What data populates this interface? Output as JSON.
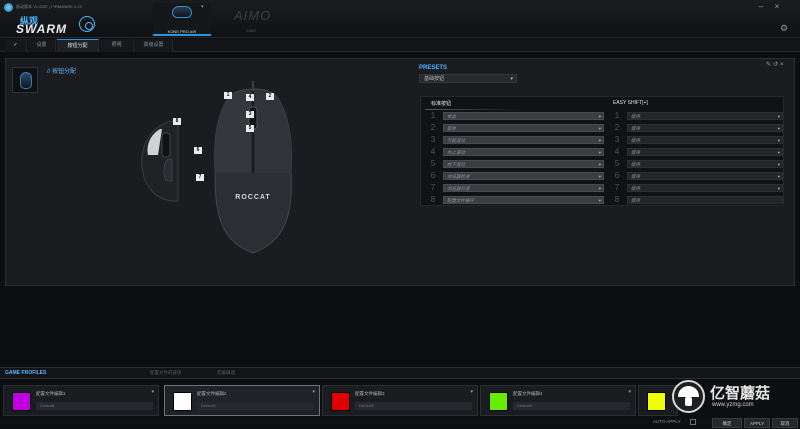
{
  "app": {
    "title_line": "驱动版本 V1.0297 | FIRMWARE 4.10",
    "brand_cn": "纵观",
    "brand_name": "SWARM"
  },
  "devices": [
    {
      "name": "KONE PRO AIR",
      "selected": true
    },
    {
      "name": "AIMO",
      "subtitle": "AIMO",
      "selected": false
    }
  ],
  "tabs": [
    {
      "label": "✔",
      "active": false
    },
    {
      "label": "设置",
      "active": false
    },
    {
      "label": "按钮分配",
      "active": true
    },
    {
      "label": "照明",
      "active": false
    },
    {
      "label": "高级设置",
      "active": false
    }
  ],
  "main": {
    "section_title": "// 按钮分配",
    "presets_label": "PRESETS",
    "preset_value": "基础按钮",
    "col_standard": "标准按钮",
    "col_easyshift": "EASY SHIFT[+]",
    "mouse_logo": "ROCCAT"
  },
  "button_markers": [
    "1",
    "2",
    "3",
    "4",
    "5",
    "6",
    "7",
    "8"
  ],
  "standard_rows": [
    {
      "num": "1",
      "value": "单击"
    },
    {
      "num": "2",
      "value": "菜单"
    },
    {
      "num": "3",
      "value": "万能滚动"
    },
    {
      "num": "4",
      "value": "向上滚动"
    },
    {
      "num": "5",
      "value": "向下滚动"
    },
    {
      "num": "6",
      "value": "浏览器前进"
    },
    {
      "num": "7",
      "value": "浏览器后退"
    },
    {
      "num": "8",
      "value": "配置文件循环"
    }
  ],
  "easyshift_rows": [
    {
      "num": "1",
      "value": "禁用"
    },
    {
      "num": "2",
      "value": "禁用"
    },
    {
      "num": "3",
      "value": "禁用"
    },
    {
      "num": "4",
      "value": "禁用"
    },
    {
      "num": "5",
      "value": "禁用"
    },
    {
      "num": "6",
      "value": "禁用"
    },
    {
      "num": "7",
      "value": "禁用"
    },
    {
      "num": "8",
      "value": "禁用"
    }
  ],
  "bottom_tabs": {
    "game_profiles": "GAME PROFILES",
    "tab2": "配置文件的链接",
    "tab3": "宏编辑器"
  },
  "profiles": [
    {
      "name": "配置文件编辑1",
      "default": "Default1",
      "color": "#c000e0"
    },
    {
      "name": "配置文件编辑2",
      "default": "Default2",
      "color": "#ffffff"
    },
    {
      "name": "配置文件编辑3",
      "default": "Default3",
      "color": "#e00000"
    },
    {
      "name": "配置文件编辑4",
      "default": "Default4",
      "color": "#66ee00"
    },
    {
      "name": "",
      "default": "",
      "color": "#eeff00"
    }
  ],
  "footer": {
    "auto_apply": "AUTO APPLY",
    "confirm": "确定",
    "apply": "APPLY",
    "cancel": "取消"
  },
  "watermark": {
    "text": "亿智蘑菇",
    "url": "www.yzmg.com"
  },
  "accent_color": "#3b9be6"
}
